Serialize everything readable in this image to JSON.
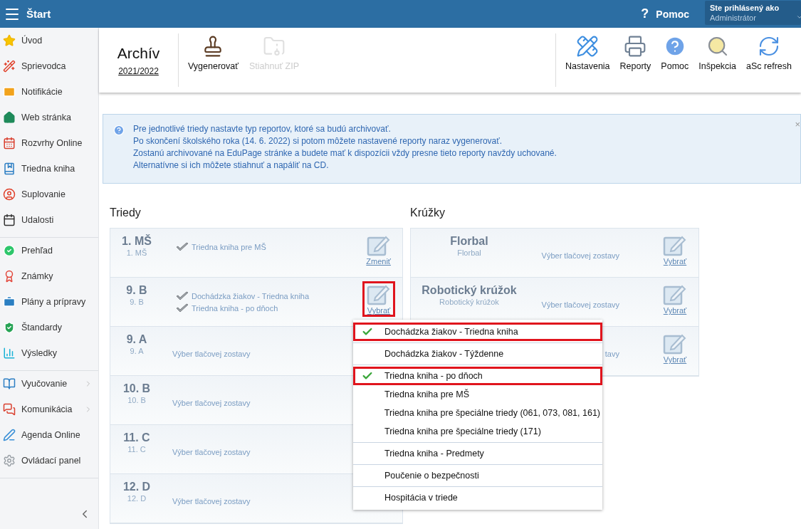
{
  "topbar": {
    "title": "Štart",
    "help": {
      "icon": "?",
      "label": "Pomoc"
    },
    "user": {
      "caption": "Ste prihlásený ako",
      "name": "Administrátor"
    }
  },
  "sidebar": {
    "groups": [
      [
        {
          "kind": "star",
          "label": "Úvod",
          "has_submenu": false
        },
        {
          "kind": "wand",
          "label": "Sprievodca",
          "has_submenu": false
        },
        {
          "kind": "mail",
          "label": "Notifikácie",
          "has_submenu": false
        },
        {
          "kind": "house",
          "label": "Web stránka",
          "has_submenu": false
        },
        {
          "kind": "timetable",
          "label": "Rozvrhy Online",
          "has_submenu": false
        },
        {
          "kind": "book",
          "label": "Triedna kniha",
          "has_submenu": false
        },
        {
          "kind": "person",
          "label": "Suplovanie",
          "has_submenu": false
        },
        {
          "kind": "calendar",
          "label": "Udalosti",
          "has_submenu": false
        }
      ],
      [
        {
          "kind": "check",
          "label": "Prehľad",
          "has_submenu": false
        },
        {
          "kind": "grade",
          "label": "Známky",
          "has_submenu": false
        },
        {
          "kind": "briefcase",
          "label": "Plány a prípravy",
          "has_submenu": false
        },
        {
          "kind": "shield",
          "label": "Štandardy",
          "has_submenu": false
        },
        {
          "kind": "chart",
          "label": "Výsledky",
          "has_submenu": false
        }
      ],
      [
        {
          "kind": "open-book",
          "label": "Vyučovanie",
          "has_submenu": true
        },
        {
          "kind": "chat",
          "label": "Komunikácia",
          "has_submenu": true
        },
        {
          "kind": "pen",
          "label": "Agenda Online",
          "has_submenu": false
        },
        {
          "kind": "gear",
          "label": "Ovládací panel",
          "has_submenu": false
        }
      ]
    ]
  },
  "toolbar": {
    "title": "Archív",
    "year": "2021/2022",
    "left_buttons": [
      {
        "kind": "stamp",
        "label": "Vygenerovať",
        "disabled": false
      },
      {
        "kind": "zip",
        "label": "Stiahnuť ZIP",
        "disabled": true
      }
    ],
    "right_buttons": [
      {
        "kind": "settings",
        "label": "Nastavenia",
        "disabled": false
      },
      {
        "kind": "print",
        "label": "Reporty",
        "disabled": false
      },
      {
        "kind": "help",
        "label": "Pomoc",
        "disabled": false
      },
      {
        "kind": "inspect",
        "label": "Inšpekcia",
        "disabled": false
      },
      {
        "kind": "refresh",
        "label": "aSc refresh",
        "disabled": false
      }
    ]
  },
  "info": {
    "lines": [
      "Pre jednotlivé triedy nastavte typ reportov, ktoré sa budú archivovať.",
      "Po skončení školského roka (14. 6. 2022) si potom môžete nastavené reporty naraz vygenerovať.",
      "Zostanú archivované na EduPage stránke a budete mať k dispozícii vždy presne tieto reporty navždy uchované.",
      "Alternatívne si ich môžete stiahnuť a napáliť na CD."
    ],
    "close": "×"
  },
  "classes": {
    "heading": "Triedy",
    "rows": [
      {
        "name": "1. MŠ",
        "subtitle": "1. MŠ",
        "reports": [
          "Triedna kniha pre MŠ"
        ],
        "no_report_text": null,
        "edit": {
          "label": "Zmeniť",
          "highlighted": false
        }
      },
      {
        "name": "9. B",
        "subtitle": "9. B",
        "reports": [
          "Dochádzka žiakov - Triedna kniha",
          "Triedna kniha - po dňoch"
        ],
        "no_report_text": null,
        "edit": {
          "label": "Vybrať",
          "highlighted": true
        }
      },
      {
        "name": "9. A",
        "subtitle": "9. A",
        "reports": [],
        "no_report_text": "Výber tlačovej zostavy",
        "edit": null
      },
      {
        "name": "10. B",
        "subtitle": "10. B",
        "reports": [],
        "no_report_text": "Výber tlačovej zostavy",
        "edit": null
      },
      {
        "name": "11. C",
        "subtitle": "11. C",
        "reports": [],
        "no_report_text": "Výber tlačovej zostavy",
        "edit": null
      },
      {
        "name": "12. D",
        "subtitle": "12. D",
        "reports": [],
        "no_report_text": "Výber tlačovej zostavy",
        "edit": null
      }
    ]
  },
  "clubs": {
    "heading": "Krúžky",
    "rows": [
      {
        "name": "Florbal",
        "subtitle": "Florbal",
        "no_report_text": "Výber tlačovej zostavy",
        "edit": {
          "label": "Vybrať",
          "highlighted": false
        }
      },
      {
        "name": "Robotický krúžok",
        "subtitle": "Robotický krúžok",
        "no_report_text": "Výber tlačovej zostavy",
        "edit": {
          "label": "Vybrať",
          "highlighted": false
        }
      },
      {
        "name": null,
        "subtitle": null,
        "no_report_text": "tavy",
        "edit": {
          "label": "Vybrať",
          "highlighted": false
        }
      }
    ]
  },
  "dropdown": {
    "groups": [
      [
        {
          "label": "Dochádzka žiakov - Triedna kniha",
          "checked": true,
          "highlighted": true
        }
      ],
      [
        {
          "label": "Dochádzka žiakov - Týždenne",
          "checked": false,
          "highlighted": false
        }
      ],
      [
        {
          "label": "Triedna kniha - po dňoch",
          "checked": true,
          "highlighted": true
        },
        {
          "label": "Triedna kniha pre MŠ",
          "checked": false,
          "highlighted": false
        },
        {
          "label": "Triedna kniha pre špeciálne triedy (061, 073, 081, 161)",
          "checked": false,
          "highlighted": false
        },
        {
          "label": "Triedna kniha pre špeciálne triedy (171)",
          "checked": false,
          "highlighted": false
        }
      ],
      [
        {
          "label": "Triedna kniha - Predmety",
          "checked": false,
          "highlighted": false
        }
      ],
      [
        {
          "label": "Poučenie o bezpečnosti",
          "checked": false,
          "highlighted": false
        }
      ],
      [
        {
          "label": "Hospitácia v triede",
          "checked": false,
          "highlighted": false
        }
      ]
    ]
  }
}
